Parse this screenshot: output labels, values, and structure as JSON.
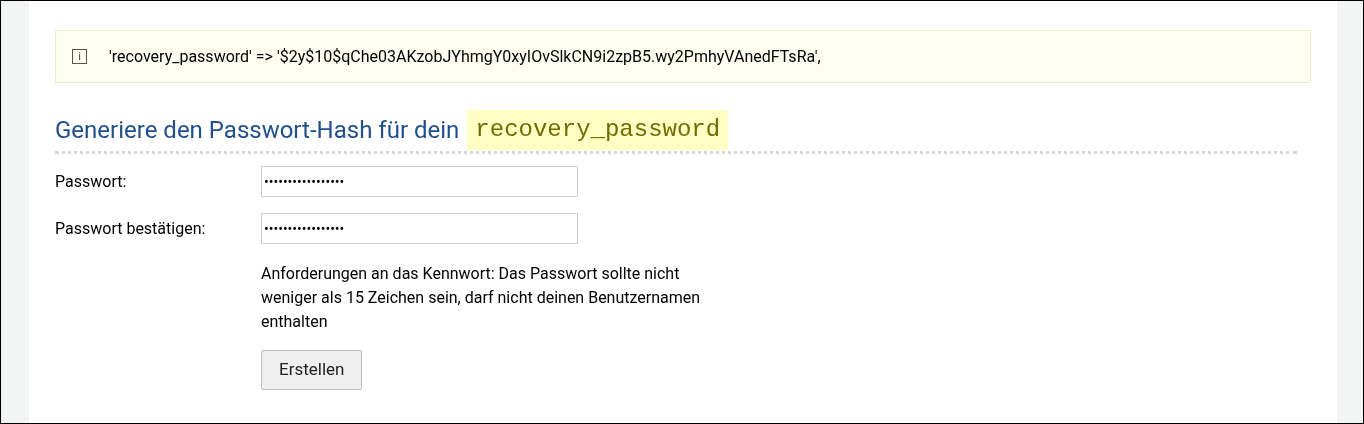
{
  "notice": {
    "icon": "i",
    "text": "'recovery_password' => '$2y$10$qChe03AKzobJYhmgY0xyIOvSlkCN9i2zpB5.wy2PmhyVAnedFTsRa',"
  },
  "heading": {
    "text": "Generiere den Passwort-Hash für dein",
    "code": "recovery_password"
  },
  "fields": [
    {
      "label": "Passwort:",
      "value": "•••••••••••••••••"
    },
    {
      "label": "Passwort bestätigen:",
      "value": "•••••••••••••••••"
    }
  ],
  "hint": "Anforderungen an das Kennwort: Das Passwort sollte nicht weniger als 15 Zeichen sein, darf nicht deinen Benutzernamen enthalten",
  "button": "Erstellen"
}
